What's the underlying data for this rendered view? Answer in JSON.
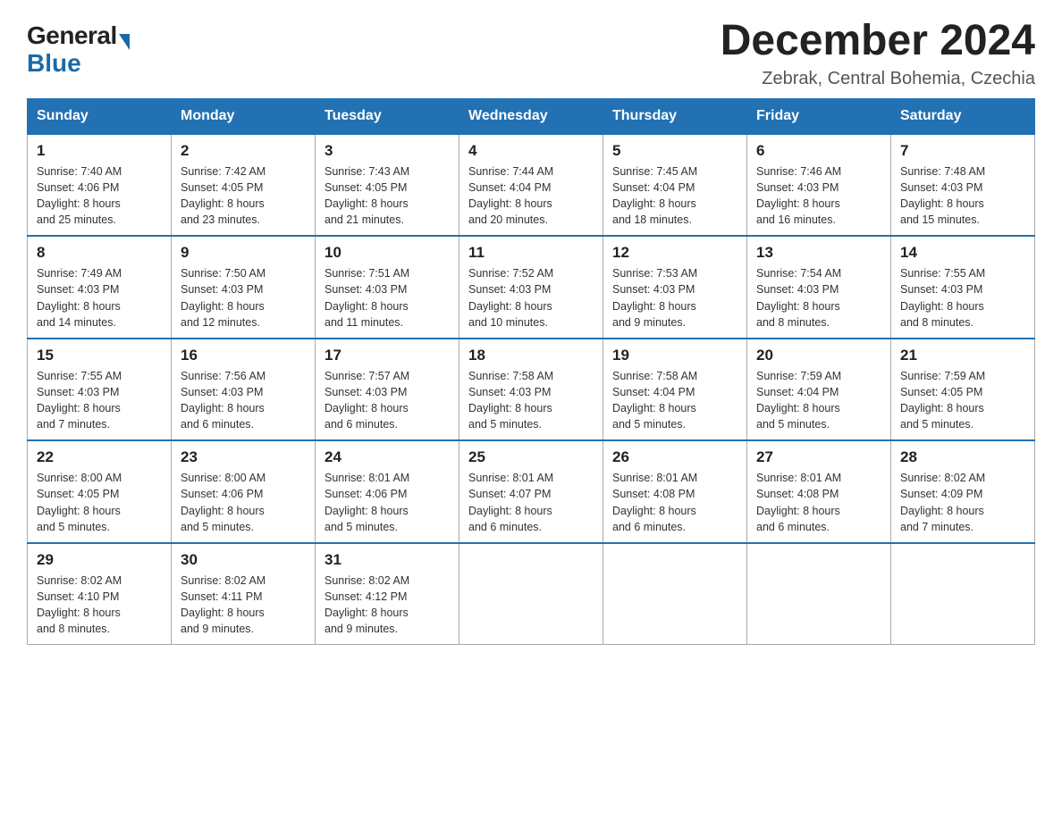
{
  "header": {
    "logo": {
      "general": "General",
      "arrow": "▶",
      "blue": "Blue"
    },
    "title": "December 2024",
    "subtitle": "Zebrak, Central Bohemia, Czechia"
  },
  "weekdays": [
    "Sunday",
    "Monday",
    "Tuesday",
    "Wednesday",
    "Thursday",
    "Friday",
    "Saturday"
  ],
  "weeks": [
    [
      {
        "day": "1",
        "sunrise": "7:40 AM",
        "sunset": "4:06 PM",
        "daylight": "8 hours and 25 minutes."
      },
      {
        "day": "2",
        "sunrise": "7:42 AM",
        "sunset": "4:05 PM",
        "daylight": "8 hours and 23 minutes."
      },
      {
        "day": "3",
        "sunrise": "7:43 AM",
        "sunset": "4:05 PM",
        "daylight": "8 hours and 21 minutes."
      },
      {
        "day": "4",
        "sunrise": "7:44 AM",
        "sunset": "4:04 PM",
        "daylight": "8 hours and 20 minutes."
      },
      {
        "day": "5",
        "sunrise": "7:45 AM",
        "sunset": "4:04 PM",
        "daylight": "8 hours and 18 minutes."
      },
      {
        "day": "6",
        "sunrise": "7:46 AM",
        "sunset": "4:03 PM",
        "daylight": "8 hours and 16 minutes."
      },
      {
        "day": "7",
        "sunrise": "7:48 AM",
        "sunset": "4:03 PM",
        "daylight": "8 hours and 15 minutes."
      }
    ],
    [
      {
        "day": "8",
        "sunrise": "7:49 AM",
        "sunset": "4:03 PM",
        "daylight": "8 hours and 14 minutes."
      },
      {
        "day": "9",
        "sunrise": "7:50 AM",
        "sunset": "4:03 PM",
        "daylight": "8 hours and 12 minutes."
      },
      {
        "day": "10",
        "sunrise": "7:51 AM",
        "sunset": "4:03 PM",
        "daylight": "8 hours and 11 minutes."
      },
      {
        "day": "11",
        "sunrise": "7:52 AM",
        "sunset": "4:03 PM",
        "daylight": "8 hours and 10 minutes."
      },
      {
        "day": "12",
        "sunrise": "7:53 AM",
        "sunset": "4:03 PM",
        "daylight": "8 hours and 9 minutes."
      },
      {
        "day": "13",
        "sunrise": "7:54 AM",
        "sunset": "4:03 PM",
        "daylight": "8 hours and 8 minutes."
      },
      {
        "day": "14",
        "sunrise": "7:55 AM",
        "sunset": "4:03 PM",
        "daylight": "8 hours and 8 minutes."
      }
    ],
    [
      {
        "day": "15",
        "sunrise": "7:55 AM",
        "sunset": "4:03 PM",
        "daylight": "8 hours and 7 minutes."
      },
      {
        "day": "16",
        "sunrise": "7:56 AM",
        "sunset": "4:03 PM",
        "daylight": "8 hours and 6 minutes."
      },
      {
        "day": "17",
        "sunrise": "7:57 AM",
        "sunset": "4:03 PM",
        "daylight": "8 hours and 6 minutes."
      },
      {
        "day": "18",
        "sunrise": "7:58 AM",
        "sunset": "4:03 PM",
        "daylight": "8 hours and 5 minutes."
      },
      {
        "day": "19",
        "sunrise": "7:58 AM",
        "sunset": "4:04 PM",
        "daylight": "8 hours and 5 minutes."
      },
      {
        "day": "20",
        "sunrise": "7:59 AM",
        "sunset": "4:04 PM",
        "daylight": "8 hours and 5 minutes."
      },
      {
        "day": "21",
        "sunrise": "7:59 AM",
        "sunset": "4:05 PM",
        "daylight": "8 hours and 5 minutes."
      }
    ],
    [
      {
        "day": "22",
        "sunrise": "8:00 AM",
        "sunset": "4:05 PM",
        "daylight": "8 hours and 5 minutes."
      },
      {
        "day": "23",
        "sunrise": "8:00 AM",
        "sunset": "4:06 PM",
        "daylight": "8 hours and 5 minutes."
      },
      {
        "day": "24",
        "sunrise": "8:01 AM",
        "sunset": "4:06 PM",
        "daylight": "8 hours and 5 minutes."
      },
      {
        "day": "25",
        "sunrise": "8:01 AM",
        "sunset": "4:07 PM",
        "daylight": "8 hours and 6 minutes."
      },
      {
        "day": "26",
        "sunrise": "8:01 AM",
        "sunset": "4:08 PM",
        "daylight": "8 hours and 6 minutes."
      },
      {
        "day": "27",
        "sunrise": "8:01 AM",
        "sunset": "4:08 PM",
        "daylight": "8 hours and 6 minutes."
      },
      {
        "day": "28",
        "sunrise": "8:02 AM",
        "sunset": "4:09 PM",
        "daylight": "8 hours and 7 minutes."
      }
    ],
    [
      {
        "day": "29",
        "sunrise": "8:02 AM",
        "sunset": "4:10 PM",
        "daylight": "8 hours and 8 minutes."
      },
      {
        "day": "30",
        "sunrise": "8:02 AM",
        "sunset": "4:11 PM",
        "daylight": "8 hours and 9 minutes."
      },
      {
        "day": "31",
        "sunrise": "8:02 AM",
        "sunset": "4:12 PM",
        "daylight": "8 hours and 9 minutes."
      },
      null,
      null,
      null,
      null
    ]
  ],
  "labels": {
    "sunrise": "Sunrise:",
    "sunset": "Sunset:",
    "daylight": "Daylight:"
  }
}
